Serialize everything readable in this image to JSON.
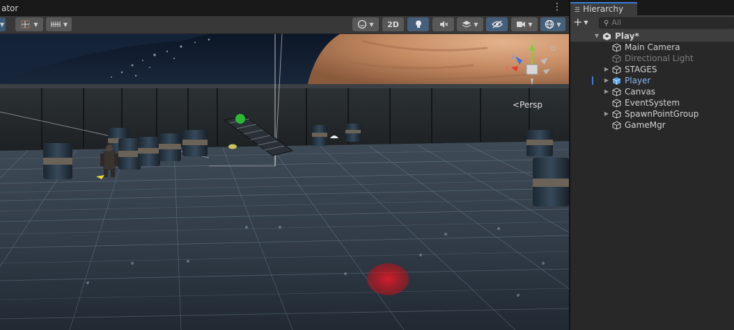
{
  "scene": {
    "tab_title": "ator",
    "more_icon": "⋮",
    "toolbar": {
      "button_2d": "2D"
    },
    "persp_label": "<Persp",
    "gizmo_axes": {
      "x": "x",
      "y": "y",
      "z": "z"
    }
  },
  "hierarchy": {
    "tab_title": "Hierarchy",
    "add_symbol": "+",
    "search_placeholder": "All",
    "items": [
      {
        "label": "Play*"
      },
      {
        "label": "Main Camera"
      },
      {
        "label": "Directional Light"
      },
      {
        "label": "STAGES"
      },
      {
        "label": "Player"
      },
      {
        "label": "Canvas"
      },
      {
        "label": "EventSystem"
      },
      {
        "label": "SpawnPointGroup"
      },
      {
        "label": "GameMgr"
      }
    ]
  },
  "colors": {
    "accent": "#3a7dd8",
    "selected_text": "#8ab6ec",
    "disabled_text": "#7d7d7d"
  }
}
